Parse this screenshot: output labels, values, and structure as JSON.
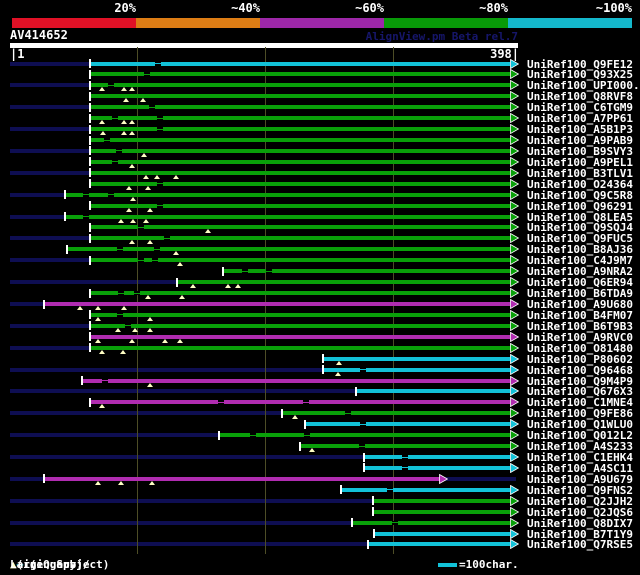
{
  "header": {
    "query_id": "AV414652",
    "watermark": "AlignView.pm Beta rel.7",
    "scale": {
      "labels": [
        "20%",
        "~40%",
        "~60%",
        "~80%",
        "~100%"
      ],
      "colors": [
        "#e01126",
        "#dd7d15",
        "#9d27a8",
        "#089a08",
        "#14b8cc"
      ]
    }
  },
  "ruler": {
    "start_label": "|1",
    "end_label": "398|",
    "min": 1,
    "max": 398,
    "gridlines": [
      100,
      200,
      300
    ]
  },
  "legend": {
    "prefix": "Large gaps: ",
    "triangle": "▲",
    "query_text": "(in Query)/",
    "dash": "–",
    "subject_text": " (in Subject)",
    "unit_text": "=100char."
  },
  "colors": {
    "green": "#09a009",
    "magenta": "#b02cb0",
    "cyan": "#12c2d8",
    "band": "#0e0e52",
    "gridline": "#4d4d26",
    "triangle": "#ffffc4"
  },
  "chart_data": {
    "type": "bar",
    "subtype": "pairwise-alignment-overview",
    "title": "AV414652",
    "xlabel": "query position (residues)",
    "xlim": [
      1,
      398
    ],
    "identity_legend_bins": [
      "20%",
      "~40%",
      "~60%",
      "~80%",
      "~100%"
    ],
    "rows": [
      {
        "label": "UniRef100_Q9FE12",
        "color": "cyan",
        "start": 64,
        "end": 398,
        "query_gaps": [],
        "subject_gaps": [
          117
        ]
      },
      {
        "label": "UniRef100_Q93X25",
        "color": "green",
        "start": 64,
        "end": 398,
        "query_gaps": [],
        "subject_gaps": [
          108
        ]
      },
      {
        "label": "UniRef100_UPI000..",
        "color": "green",
        "start": 64,
        "end": 398,
        "query_gaps": [
          73,
          90,
          96
        ],
        "subject_gaps": [
          80
        ]
      },
      {
        "label": "UniRef100_Q8RVF8",
        "color": "green",
        "start": 64,
        "end": 398,
        "query_gaps": [
          92,
          105
        ],
        "subject_gaps": []
      },
      {
        "label": "UniRef100_C6TGM9",
        "color": "green",
        "start": 64,
        "end": 398,
        "query_gaps": [],
        "subject_gaps": [
          112
        ]
      },
      {
        "label": "UniRef100_A7PP61",
        "color": "green",
        "start": 64,
        "end": 398,
        "query_gaps": [
          73,
          90,
          96
        ],
        "subject_gaps": [
          83,
          118
        ]
      },
      {
        "label": "UniRef100_A5B1P3",
        "color": "green",
        "start": 64,
        "end": 398,
        "query_gaps": [
          74,
          90,
          96
        ],
        "subject_gaps": [
          118
        ]
      },
      {
        "label": "UniRef100_A9PAB9",
        "color": "green",
        "start": 64,
        "end": 398,
        "query_gaps": [],
        "subject_gaps": [
          77
        ]
      },
      {
        "label": "UniRef100_B9SVY3",
        "color": "green",
        "start": 64,
        "end": 398,
        "query_gaps": [
          106
        ],
        "subject_gaps": [
          86
        ]
      },
      {
        "label": "UniRef100_A9PEL1",
        "color": "green",
        "start": 64,
        "end": 398,
        "query_gaps": [
          96
        ],
        "subject_gaps": [
          83
        ]
      },
      {
        "label": "UniRef100_B3TLV1",
        "color": "green",
        "start": 64,
        "end": 398,
        "query_gaps": [
          107,
          116,
          131
        ],
        "subject_gaps": []
      },
      {
        "label": "UniRef100_O24364",
        "color": "green",
        "start": 64,
        "end": 398,
        "query_gaps": [
          94,
          109
        ],
        "subject_gaps": [
          118
        ]
      },
      {
        "label": "UniRef100_Q9C5R8",
        "color": "green",
        "start": 44,
        "end": 398,
        "query_gaps": [
          97
        ],
        "subject_gaps": [
          60,
          80
        ]
      },
      {
        "label": "UniRef100_Q96291",
        "color": "green",
        "start": 64,
        "end": 398,
        "query_gaps": [
          94,
          110
        ],
        "subject_gaps": [
          118
        ]
      },
      {
        "label": "UniRef100_Q8LEA5",
        "color": "green",
        "start": 44,
        "end": 398,
        "query_gaps": [
          88,
          97,
          107
        ],
        "subject_gaps": [
          60
        ]
      },
      {
        "label": "UniRef100_Q9SQJ4",
        "color": "green",
        "start": 64,
        "end": 398,
        "query_gaps": [
          156
        ],
        "subject_gaps": [
          103
        ]
      },
      {
        "label": "UniRef100_Q9FUC5",
        "color": "green",
        "start": 64,
        "end": 398,
        "query_gaps": [
          96,
          110
        ],
        "subject_gaps": [
          124
        ]
      },
      {
        "label": "UniRef100_B8AJ36",
        "color": "green",
        "start": 46,
        "end": 398,
        "query_gaps": [
          131
        ],
        "subject_gaps": [
          87,
          116
        ]
      },
      {
        "label": "UniRef100_C4J9M7",
        "color": "green",
        "start": 64,
        "end": 398,
        "query_gaps": [
          134
        ],
        "subject_gaps": [
          103,
          114
        ]
      },
      {
        "label": "UniRef100_A9NRA2",
        "color": "green",
        "start": 168,
        "end": 398,
        "query_gaps": [],
        "subject_gaps": [
          185,
          203
        ]
      },
      {
        "label": "UniRef100_Q6ER94",
        "color": "green",
        "start": 132,
        "end": 398,
        "query_gaps": [
          144,
          171,
          179
        ],
        "subject_gaps": []
      },
      {
        "label": "UniRef100_B6TDA9",
        "color": "green",
        "start": 64,
        "end": 398,
        "query_gaps": [
          109,
          135
        ],
        "subject_gaps": [
          88,
          100
        ]
      },
      {
        "label": "UniRef100_A9U680",
        "color": "magenta",
        "start": 28,
        "end": 398,
        "query_gaps": [
          56,
          70,
          90
        ],
        "subject_gaps": []
      },
      {
        "label": "UniRef100_B4FM07",
        "color": "green",
        "start": 64,
        "end": 398,
        "query_gaps": [
          70,
          110
        ],
        "subject_gaps": [
          87
        ]
      },
      {
        "label": "UniRef100_B6T9B3",
        "color": "green",
        "start": 64,
        "end": 398,
        "query_gaps": [
          85,
          99,
          110
        ],
        "subject_gaps": [
          93
        ]
      },
      {
        "label": "UniRef100_A9RVC0",
        "color": "magenta",
        "start": 64,
        "end": 398,
        "query_gaps": [
          70,
          96,
          122,
          134
        ],
        "subject_gaps": []
      },
      {
        "label": "UniRef100_O81480",
        "color": "green",
        "start": 64,
        "end": 398,
        "query_gaps": [
          73,
          89
        ],
        "subject_gaps": []
      },
      {
        "label": "UniRef100_P80602",
        "color": "cyan",
        "start": 246,
        "end": 398,
        "query_gaps": [
          258
        ],
        "subject_gaps": []
      },
      {
        "label": "UniRef100_Q96468",
        "color": "cyan",
        "start": 246,
        "end": 398,
        "query_gaps": [
          257
        ],
        "subject_gaps": [
          277
        ]
      },
      {
        "label": "UniRef100_Q9M4P9",
        "color": "magenta",
        "start": 58,
        "end": 398,
        "query_gaps": [
          110
        ],
        "subject_gaps": [
          75
        ]
      },
      {
        "label": "UniRef100_Q676X3",
        "color": "cyan",
        "start": 272,
        "end": 398,
        "query_gaps": [],
        "subject_gaps": []
      },
      {
        "label": "UniRef100_C1MNE4",
        "color": "magenta",
        "start": 64,
        "end": 398,
        "query_gaps": [
          73
        ],
        "subject_gaps": [
          166,
          232
        ]
      },
      {
        "label": "UniRef100_Q9FE86",
        "color": "green",
        "start": 214,
        "end": 398,
        "query_gaps": [
          224
        ],
        "subject_gaps": [
          265
        ]
      },
      {
        "label": "UniRef100_Q1WLU0",
        "color": "cyan",
        "start": 232,
        "end": 398,
        "query_gaps": [],
        "subject_gaps": [
          277
        ]
      },
      {
        "label": "UniRef100_Q012L2",
        "color": "green",
        "start": 165,
        "end": 398,
        "query_gaps": [],
        "subject_gaps": [
          191,
          233
        ]
      },
      {
        "label": "UniRef100_A4S233",
        "color": "green",
        "start": 228,
        "end": 398,
        "query_gaps": [
          237
        ],
        "subject_gaps": [
          276
        ]
      },
      {
        "label": "UniRef100_C1EHK4",
        "color": "cyan",
        "start": 278,
        "end": 398,
        "query_gaps": [],
        "subject_gaps": [
          310
        ]
      },
      {
        "label": "UniRef100_A4SC11",
        "color": "cyan",
        "start": 278,
        "end": 398,
        "query_gaps": [],
        "subject_gaps": [
          310
        ]
      },
      {
        "label": "UniRef100_A9U679",
        "color": "magenta",
        "start": 28,
        "end": 343,
        "query_gaps": [
          70,
          88,
          112
        ],
        "subject_gaps": []
      },
      {
        "label": "UniRef100_Q9FNS2",
        "color": "cyan",
        "start": 260,
        "end": 398,
        "query_gaps": [],
        "subject_gaps": [
          298
        ]
      },
      {
        "label": "UniRef100_Q2JJH2",
        "color": "green",
        "start": 285,
        "end": 398,
        "query_gaps": [],
        "subject_gaps": []
      },
      {
        "label": "UniRef100_Q2JQS6",
        "color": "green",
        "start": 285,
        "end": 398,
        "query_gaps": [],
        "subject_gaps": []
      },
      {
        "label": "UniRef100_Q8DIX7",
        "color": "green",
        "start": 269,
        "end": 398,
        "query_gaps": [],
        "subject_gaps": [
          302
        ]
      },
      {
        "label": "UniRef100_B7T1Y9",
        "color": "cyan",
        "start": 286,
        "end": 398,
        "query_gaps": [],
        "subject_gaps": []
      },
      {
        "label": "UniRef100_Q7RSE5",
        "color": "cyan",
        "start": 281,
        "end": 398,
        "query_gaps": [],
        "subject_gaps": []
      }
    ]
  }
}
